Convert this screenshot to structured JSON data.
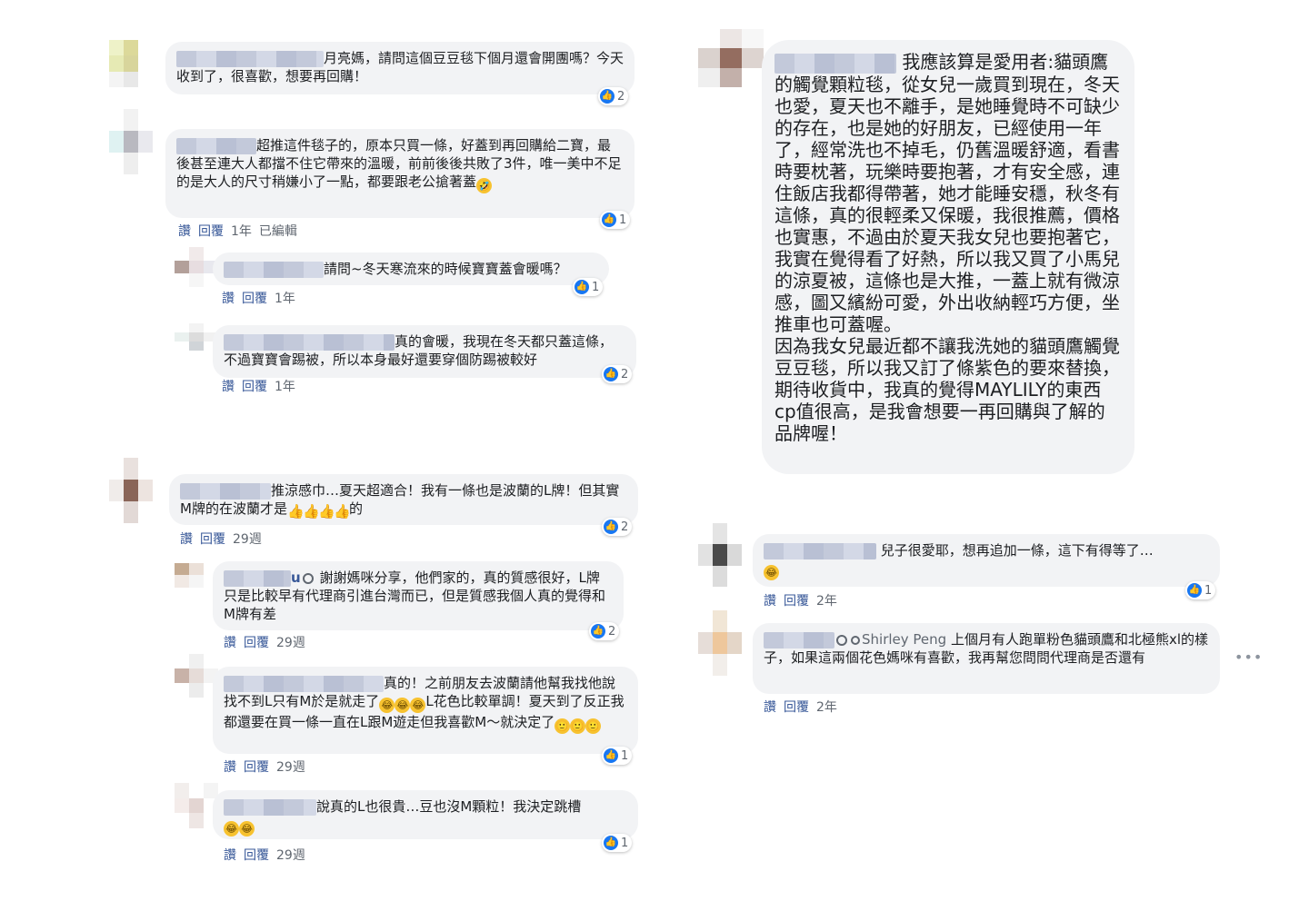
{
  "actions": {
    "like": "讚",
    "reply": "回覆"
  },
  "comments": [
    {
      "text": "月亮媽，請問這個豆豆毯下個月還會開團嗎？今天收到了，很喜歡，想要再回購！",
      "reactions": "2"
    },
    {
      "text": "超推這件毯子的，原本只買一條，好蓋到再回購給二寶，最後甚至連大人都擋不住它帶來的溫暖，前前後後共敗了3件，唯一美中不足的是大人的尺寸稍嫌小了一點，都要跟老公搶著蓋",
      "emoji": "🤣",
      "reactions": "1",
      "time": "1年",
      "edited": "已編輯"
    },
    {
      "text": "請問~冬天寒流來的時候寶寶蓋會暖嗎？",
      "reactions": "1",
      "time": "1年"
    },
    {
      "text": "真的會暖，我現在冬天都只蓋這條，不過寶寶會踢被，所以本身最好還要穿個防踢被較好",
      "reactions": "2",
      "time": "1年"
    },
    {
      "text": "推涼感巾…夏天超適合！我有一條也是波蘭的L牌！但其實M牌的在波蘭才是",
      "text_after": "的",
      "emoji": "👍",
      "reactions": "2",
      "time": "29週"
    },
    {
      "text": "謝謝媽咪分享，他們家的，真的質感很好，L牌只是比較早有代理商引進台灣而已，但是質感我個人真的覺得和M牌有差",
      "name_suffix": "u",
      "reactions": "2",
      "time": "29週"
    },
    {
      "text": "真的！之前朋友去波蘭請他幫我找他說找不到L只有M於是就走了",
      "text_mid": "L花色比較單調！夏天到了反正我都還要在買一條一直在L跟M遊走但我喜歡M～就決定了",
      "emoji": "😂",
      "emoji2": "🙂",
      "reactions": "1",
      "time": "29週"
    },
    {
      "text": "說真的L也很貴…豆也沒M顆粒！我決定跳槽",
      "emoji": "😂",
      "reactions": "1",
      "time": "29週"
    },
    {
      "text": "我應該算是愛用者:貓頭鷹的觸覺顆粒毯，從女兒一歲買到現在，冬天也愛，夏天也不離手，是她睡覺時不可缺少的存在，也是她的好朋友，已經使用一年了，經常洗也不掉毛，仍舊溫暖舒適，看書時要枕著，玩樂時要抱著，才有安全感，連住飯店我都得帶著，她才能睡安穩，秋冬有這條，真的很輕柔又保暖，我很推薦，價格也實惠，不過由於夏天我女兒也要抱著它，我實在覺得看了好熱，所以我又買了小馬兒的涼夏被，這條也是大推，一蓋上就有微涼感，圖又繽紛可愛，外出收納輕巧方便，坐推車也可蓋喔。",
      "text2": "因為我女兒最近都不讓我洗她的貓頭鷹觸覺豆豆毯，所以我又訂了條紫色的要來替換，期待收貨中，我真的覺得MAYLILY的東西cp值很高，是我會想要一再回購與了解的品牌喔！"
    },
    {
      "text": "兒子很愛耶，想再追加一條，這下有得等了…",
      "emoji": "😂",
      "reactions": "1",
      "time": "2年"
    },
    {
      "author": "Shirley Peng",
      "text": "上個月有人跑單粉色貓頭鷹和北極熊xl的樣子，如果這兩個花色媽咪有喜歡，我再幫您問問代理商是否還有",
      "time": "2年",
      "more": "•••"
    }
  ]
}
